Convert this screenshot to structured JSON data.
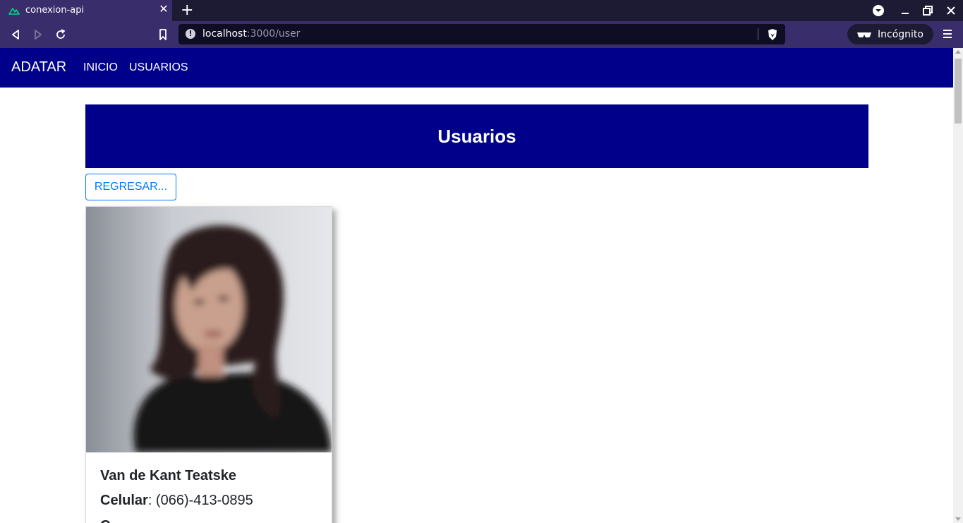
{
  "browser": {
    "tab_title": "conexion-api",
    "url_host": "localhost",
    "url_path": ":3000/user",
    "incognito_label": "Incógnito"
  },
  "navbar": {
    "brand": "ADATAR",
    "links": [
      "INICIO",
      "USUARIOS"
    ]
  },
  "hero": {
    "title": "Usuarios"
  },
  "back_button": "REGRESAR...",
  "users": [
    {
      "name": "Van de Kant Teatske",
      "phone_label": "Celular",
      "phone": ": (066)-413-0895",
      "next_field_label": "C"
    }
  ],
  "colors": {
    "navbar_bg": "#00008b",
    "hero_bg": "#00008b",
    "button_accent": "#007bff",
    "browser_chrome": "#3a2d6b"
  }
}
